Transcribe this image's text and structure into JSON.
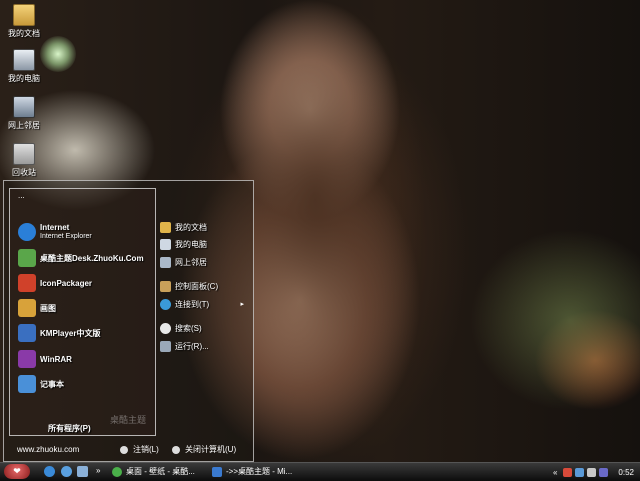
{
  "desktop": {
    "icons": [
      {
        "label": "我的文档",
        "icon": "my-documents-icon"
      },
      {
        "label": "我的电脑",
        "icon": "my-computer-icon"
      },
      {
        "label": "网上邻居",
        "icon": "network-places-icon"
      },
      {
        "label": "回收站",
        "icon": "recycle-bin-icon"
      }
    ],
    "watermark": "桌酷主题"
  },
  "start_menu": {
    "dots": "...",
    "programs": [
      {
        "title": "Internet",
        "subtitle": "Internet Explorer",
        "icon": "internet-explorer-icon",
        "color": "#2a7fd8"
      },
      {
        "title": "桌酷主题Desk.ZhuoKu.Com",
        "icon": "zhuoku-theme-icon",
        "color": "#5aa64a"
      },
      {
        "title": "IconPackager",
        "icon": "iconpackager-icon",
        "color": "#d0412a"
      },
      {
        "title": "画图",
        "icon": "paint-icon",
        "color": "#d8a23a"
      },
      {
        "title": "KMPlayer中文版",
        "icon": "kmplayer-icon",
        "color": "#3a6fc0"
      },
      {
        "title": "WinRAR",
        "icon": "winrar-icon",
        "color": "#8a3aa8"
      },
      {
        "title": "记事本",
        "icon": "notepad-icon",
        "color": "#4a90d8"
      }
    ],
    "all_programs": "所有程序(P)",
    "places": [
      {
        "label": "我的文档",
        "icon": "my-documents-icon",
        "color": "#e0b44a"
      },
      {
        "label": "我的电脑",
        "icon": "my-computer-icon",
        "color": "#cfd8e3"
      },
      {
        "label": "网上邻居",
        "icon": "network-places-icon",
        "color": "#aab8c8"
      },
      {
        "label": "控制面板(C)",
        "icon": "control-panel-icon",
        "color": "#c9a05a"
      },
      {
        "label": "连接到(T)",
        "icon": "connect-to-icon",
        "color": "#3a9ad8",
        "submenu": "▸"
      },
      {
        "label": "搜索(S)",
        "icon": "search-icon",
        "color": "#e8e8e8"
      },
      {
        "label": "运行(R)...",
        "icon": "run-icon",
        "color": "#9aa8b8"
      }
    ],
    "footer": {
      "site": "www.zhuoku.com",
      "logoff": "注销(L)",
      "shutdown": "关闭计算机(U)"
    }
  },
  "taskbar": {
    "start_glyph": "❤",
    "chevron": "»",
    "tasks": [
      {
        "label": "桌面 - 壁纸 - 桌酷...",
        "icon": "browser-icon"
      },
      {
        "label": "->>桌酷主题 - Mi...",
        "icon": "ie-window-icon"
      }
    ],
    "tray_chevron": "«",
    "clock": "0:52"
  },
  "colors": {
    "taskbar": "#1a1a1a",
    "start_button": "#c23a3a",
    "menu_border": "#dcdcdc"
  }
}
